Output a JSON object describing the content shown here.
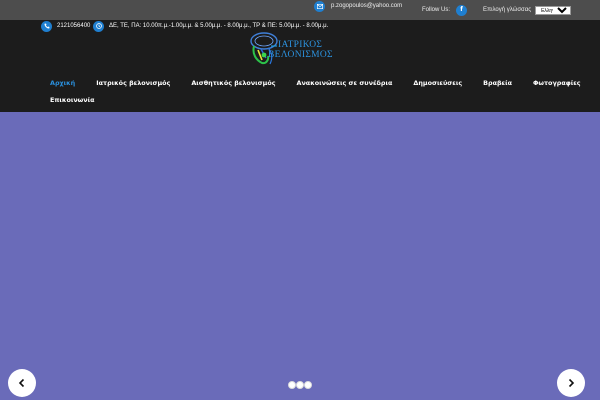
{
  "topbar": {
    "email": "p.zogopoulos@yahoo.com",
    "follow_label": "Follow Us:",
    "facebook_letter": "f",
    "language_label": "Επιλογή γλώσσας",
    "language_selected": "Ελληνικά",
    "icon_email": "envelope-icon",
    "icon_facebook": "facebook-icon"
  },
  "header": {
    "phone": "2121056400",
    "hours": "ΔΕ, ΤΕ, ΠΑ: 10.00π.μ.-1.00μ.μ. & 5.00μ.μ. - 8.00μ.μ., ΤΡ & ΠΕ: 5.00μ.μ. - 8.00μ.μ.",
    "icon_phone": "phone-icon",
    "icon_clock": "clock-icon",
    "logo_line1": "ΙΑΤΡΙΚΟΣ",
    "logo_line2": "ΒΕΛΟΝΙΣΜΟΣ"
  },
  "nav": {
    "items": [
      {
        "label": "Αρχική",
        "active": true
      },
      {
        "label": "Ιατρικός βελονισμός"
      },
      {
        "label": "Αισθητικός βελονισμός"
      },
      {
        "label": "Ανακοινώσεις σε συνέδρια"
      },
      {
        "label": "Δημοσιεύσεις"
      },
      {
        "label": "Βραβεία"
      },
      {
        "label": "Φωτογραφίες"
      },
      {
        "label": "Επικοινωνία"
      }
    ]
  },
  "slider": {
    "background": "#6a6bb9",
    "prev_icon": "chevron-left-icon",
    "next_icon": "chevron-right-icon",
    "dot_count": 3
  },
  "colors": {
    "accent": "#2a8fdc",
    "topbar": "#4d4d4d",
    "header": "#1c1c1c"
  }
}
